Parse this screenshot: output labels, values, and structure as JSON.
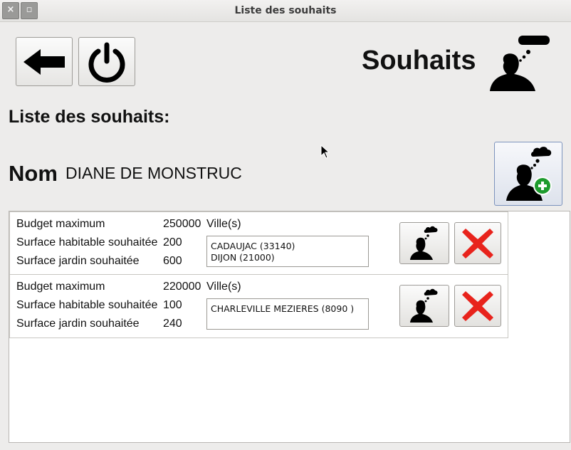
{
  "window": {
    "title": "Liste des souhaits",
    "close_glyph": "×",
    "maximize_glyph": "▫"
  },
  "toolbar": {
    "back_icon": "arrow-left-icon",
    "power_icon": "power-icon"
  },
  "header": {
    "title": "Souhaits",
    "icon": "person-thought-icon"
  },
  "main": {
    "list_label": "Liste des souhaits:",
    "nom_label": "Nom",
    "nom_value": "DIANE DE MONSTRUC",
    "add_icon": "person-thought-add-icon",
    "field_labels": {
      "budget": "Budget maximum",
      "surface_habitable": "Surface habitable souhaitée",
      "surface_jardin": "Surface jardin souhaitée",
      "villes": "Ville(s)"
    },
    "wishes": [
      {
        "budget": "250000",
        "surface_habitable": "200",
        "surface_jardin": "600",
        "villes": [
          "CADAUJAC (33140)",
          "DIJON (21000)"
        ]
      },
      {
        "budget": "220000",
        "surface_habitable": "100",
        "surface_jardin": "240",
        "villes": [
          "CHARLEVILLE MEZIERES (8090 )"
        ]
      }
    ]
  },
  "colors": {
    "delete_red": "#e8231c",
    "add_green": "#1e9b2e"
  }
}
